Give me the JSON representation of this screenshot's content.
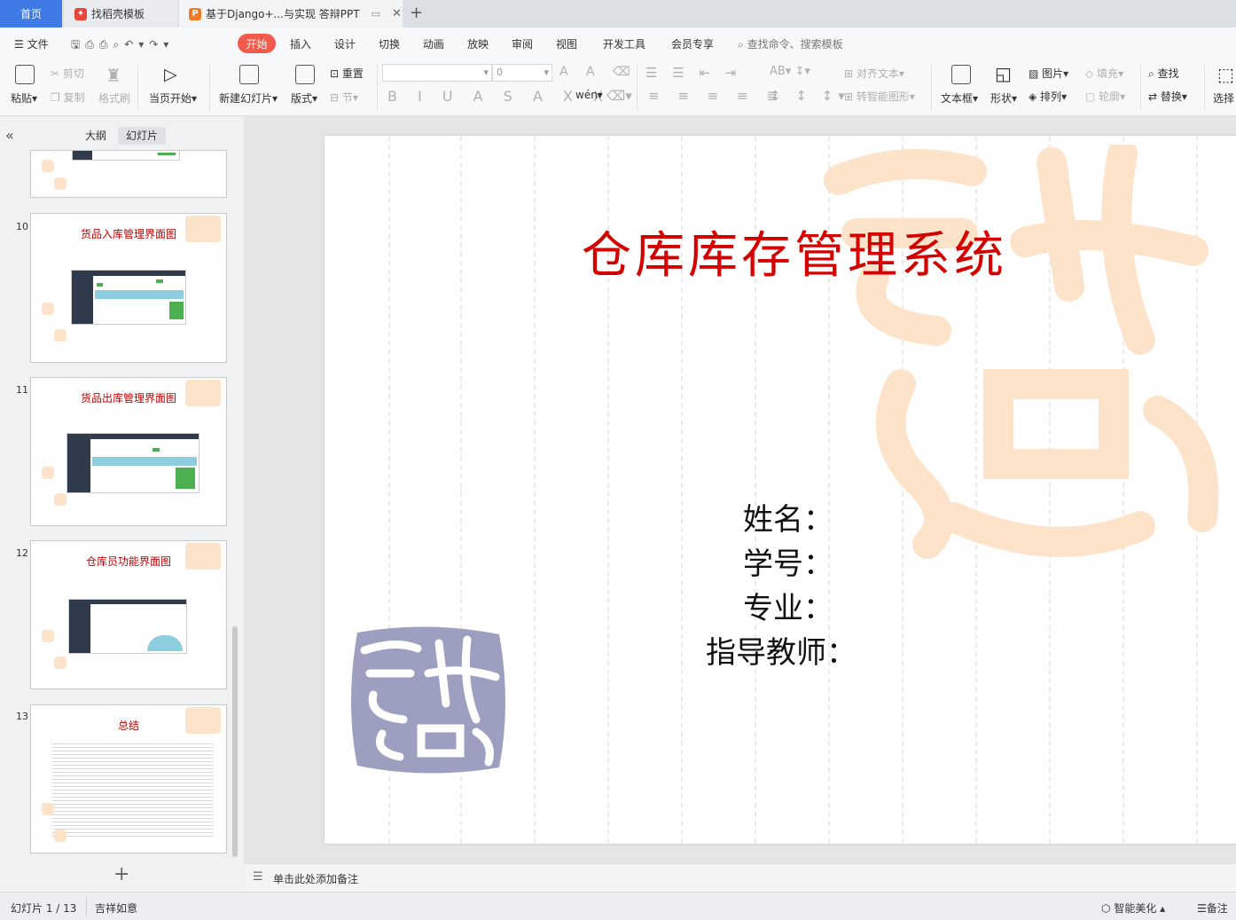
{
  "tabs": {
    "home": "首页",
    "template": "找稻壳模板",
    "document": "基于Django+...与实现 答辩PPT"
  },
  "menu": {
    "file": "文件",
    "items": [
      "开始",
      "插入",
      "设计",
      "切换",
      "动画",
      "放映",
      "审阅",
      "视图",
      "开发工具",
      "会员专享"
    ],
    "search_placeholder": "查找命令、搜索模板"
  },
  "ribbon": {
    "paste": "粘贴",
    "cut": "剪切",
    "copy": "复制",
    "format_painter": "格式刷",
    "from_current": "当页开始",
    "new_slide": "新建幻灯片",
    "layout": "版式",
    "reset": "重置",
    "section": "节",
    "font_size": "0",
    "align_text": "对齐文本",
    "smart_shape": "转智能图形",
    "text_box": "文本框",
    "shape": "形状",
    "picture": "图片",
    "arrange": "排列",
    "fill": "填充",
    "outline": "轮廓",
    "find": "查找",
    "replace": "替换",
    "select": "选择"
  },
  "panel": {
    "outline_tab": "大纲",
    "slides_tab": "幻灯片",
    "thumbs": [
      {
        "num": "10",
        "title": "货品入库管理界面图"
      },
      {
        "num": "11",
        "title": "货品出库管理界面图"
      },
      {
        "num": "12",
        "title": "仓库员功能界面图"
      },
      {
        "num": "13",
        "title": "总结"
      }
    ]
  },
  "slide": {
    "title": "仓库库存管理系统",
    "fields": [
      "姓名：",
      "学号：",
      "专业：",
      "指导教师："
    ]
  },
  "notes": {
    "placeholder": "单击此处添加备注"
  },
  "status": {
    "slide_count": "幻灯片 1 / 13",
    "theme": "吉祥如意",
    "beautify": "智能美化",
    "notes": "备注"
  },
  "colors": {
    "accent": "#f25b4b",
    "home_tab": "#3e7be6",
    "title_red": "#d40000",
    "watermark": "#fde3c9",
    "seal": "#9c9fc0"
  }
}
